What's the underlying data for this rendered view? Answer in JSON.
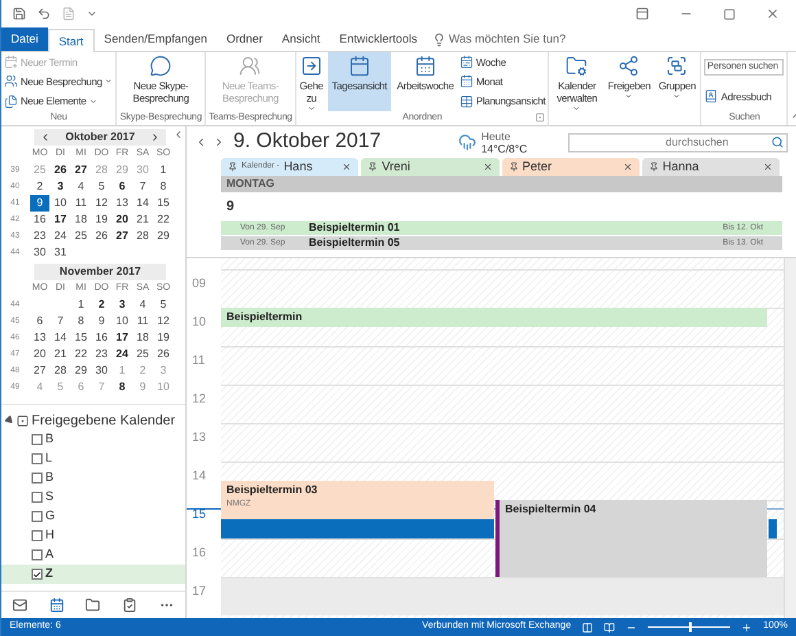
{
  "tabs": [
    {
      "label": "Datei",
      "kind": "file",
      "selected": false
    },
    {
      "label": "Start",
      "kind": "tab",
      "selected": true
    },
    {
      "label": "Senden/Empfangen",
      "kind": "tab",
      "selected": false
    },
    {
      "label": "Ordner",
      "kind": "tab",
      "selected": false
    },
    {
      "label": "Ansicht",
      "kind": "tab",
      "selected": false
    },
    {
      "label": "Entwicklertools",
      "kind": "tab",
      "selected": false
    }
  ],
  "tell_me": {
    "placeholder": "Was möchten Sie tun?"
  },
  "ribbon": {
    "groups": [
      {
        "label": "Neu",
        "items": [
          {
            "kind": "stack",
            "items": [
              {
                "kind": "small",
                "label": "Neuer Termin",
                "disabled": true,
                "dropdown": false,
                "selected": false
              },
              {
                "kind": "small",
                "label": "Neue Besprechung",
                "disabled": false,
                "dropdown": true,
                "selected": false
              },
              {
                "kind": "small",
                "label": "Neue Elemente",
                "disabled": false,
                "dropdown": true,
                "selected": false
              }
            ]
          }
        ]
      },
      {
        "label": "Skype-Besprechung",
        "items": [
          {
            "kind": "large",
            "label": "Neue Skype-Besprechung",
            "disabled": false,
            "dropdown": false,
            "selected": false
          }
        ]
      },
      {
        "label": "Teams-Besprechung",
        "items": [
          {
            "kind": "large",
            "label": "Neue Teams-Besprechung",
            "disabled": true,
            "dropdown": false,
            "selected": false
          }
        ]
      },
      {
        "label": "Anordnen",
        "launcher": true,
        "items": [
          {
            "kind": "large",
            "label": "Gehe zu",
            "disabled": false,
            "dropdown": true,
            "selected": false
          },
          {
            "kind": "large",
            "label": "Tagesansicht",
            "disabled": false,
            "dropdown": false,
            "selected": true
          },
          {
            "kind": "large",
            "label": "Arbeitswoche",
            "disabled": false,
            "dropdown": false,
            "selected": false
          },
          {
            "kind": "stack",
            "items": [
              {
                "kind": "small",
                "label": "Woche",
                "disabled": false,
                "dropdown": false,
                "selected": false
              },
              {
                "kind": "small",
                "label": "Monat",
                "disabled": false,
                "dropdown": false,
                "selected": false
              },
              {
                "kind": "small",
                "label": "Planungsansicht",
                "disabled": false,
                "dropdown": false,
                "selected": false
              }
            ]
          }
        ]
      },
      {
        "items": [
          {
            "kind": "large",
            "label": "Kalender verwalten",
            "disabled": false,
            "dropdown": true,
            "selected": false
          },
          {
            "kind": "large",
            "label": "Freigeben",
            "disabled": false,
            "dropdown": true,
            "selected": false
          },
          {
            "kind": "large",
            "label": "Gruppen",
            "disabled": false,
            "dropdown": true,
            "selected": false
          }
        ]
      },
      {
        "label": "Suchen",
        "items": [
          {
            "kind": "stack",
            "items": [
              {
                "kind": "search",
                "placeholder": "Personen suchen"
              },
              {
                "kind": "small",
                "label": "Adressbuch",
                "disabled": false,
                "dropdown": false,
                "selected": false
              }
            ]
          }
        ]
      }
    ]
  },
  "mini_calendar": {
    "months": [
      {
        "title": "Oktober 2017",
        "nav": true,
        "weekdays": [
          "MO",
          "DI",
          "MI",
          "DO",
          "FR",
          "SA",
          "SO"
        ],
        "weeks": [
          {
            "week": "39",
            "days": [
              {
                "day": "25",
                "kind": "other"
              },
              {
                "day": "26",
                "kind": "bold"
              },
              {
                "day": "27",
                "kind": "bold"
              },
              {
                "day": "28",
                "kind": "other"
              },
              {
                "day": "29",
                "kind": "other"
              },
              {
                "day": "30",
                "kind": "other"
              },
              {
                "day": "1",
                "kind": "normal"
              }
            ]
          },
          {
            "week": "40",
            "days": [
              {
                "day": "2",
                "kind": "normal"
              },
              {
                "day": "3",
                "kind": "bold"
              },
              {
                "day": "4",
                "kind": "normal"
              },
              {
                "day": "5",
                "kind": "normal"
              },
              {
                "day": "6",
                "kind": "bold"
              },
              {
                "day": "7",
                "kind": "normal"
              },
              {
                "day": "8",
                "kind": "normal"
              }
            ]
          },
          {
            "week": "41",
            "days": [
              {
                "day": "9",
                "kind": "selected"
              },
              {
                "day": "10",
                "kind": "normal"
              },
              {
                "day": "11",
                "kind": "normal"
              },
              {
                "day": "12",
                "kind": "normal"
              },
              {
                "day": "13",
                "kind": "normal"
              },
              {
                "day": "14",
                "kind": "normal"
              },
              {
                "day": "15",
                "kind": "normal"
              }
            ]
          },
          {
            "week": "42",
            "days": [
              {
                "day": "16",
                "kind": "normal"
              },
              {
                "day": "17",
                "kind": "bold"
              },
              {
                "day": "18",
                "kind": "normal"
              },
              {
                "day": "19",
                "kind": "normal"
              },
              {
                "day": "20",
                "kind": "bold"
              },
              {
                "day": "21",
                "kind": "normal"
              },
              {
                "day": "22",
                "kind": "normal"
              }
            ]
          },
          {
            "week": "43",
            "days": [
              {
                "day": "23",
                "kind": "normal"
              },
              {
                "day": "24",
                "kind": "normal"
              },
              {
                "day": "25",
                "kind": "normal"
              },
              {
                "day": "26",
                "kind": "normal"
              },
              {
                "day": "27",
                "kind": "bold"
              },
              {
                "day": "28",
                "kind": "normal"
              },
              {
                "day": "29",
                "kind": "normal"
              }
            ]
          },
          {
            "week": "44",
            "days": [
              {
                "day": "30",
                "kind": "normal"
              },
              {
                "day": "31",
                "kind": "normal"
              }
            ]
          }
        ]
      },
      {
        "title": "November 2017",
        "nav": false,
        "weekdays": [
          "MO",
          "DI",
          "MI",
          "DO",
          "FR",
          "SA",
          "SO"
        ],
        "weeks": [
          {
            "week": "44",
            "days": [
              {
                "kind": "blank"
              },
              {
                "kind": "blank"
              },
              {
                "day": "1",
                "kind": "normal"
              },
              {
                "day": "2",
                "kind": "bold"
              },
              {
                "day": "3",
                "kind": "bold"
              },
              {
                "day": "4",
                "kind": "normal"
              },
              {
                "day": "5",
                "kind": "normal"
              }
            ]
          },
          {
            "week": "45",
            "days": [
              {
                "day": "6",
                "kind": "normal"
              },
              {
                "day": "7",
                "kind": "normal"
              },
              {
                "day": "8",
                "kind": "normal"
              },
              {
                "day": "9",
                "kind": "normal"
              },
              {
                "day": "10",
                "kind": "normal"
              },
              {
                "day": "11",
                "kind": "normal"
              },
              {
                "day": "12",
                "kind": "normal"
              }
            ]
          },
          {
            "week": "46",
            "days": [
              {
                "day": "13",
                "kind": "normal"
              },
              {
                "day": "14",
                "kind": "normal"
              },
              {
                "day": "15",
                "kind": "normal"
              },
              {
                "day": "16",
                "kind": "normal"
              },
              {
                "day": "17",
                "kind": "bold"
              },
              {
                "day": "18",
                "kind": "normal"
              },
              {
                "day": "19",
                "kind": "normal"
              }
            ]
          },
          {
            "week": "47",
            "days": [
              {
                "day": "20",
                "kind": "normal"
              },
              {
                "day": "21",
                "kind": "normal"
              },
              {
                "day": "22",
                "kind": "normal"
              },
              {
                "day": "23",
                "kind": "normal"
              },
              {
                "day": "24",
                "kind": "bold"
              },
              {
                "day": "25",
                "kind": "normal"
              },
              {
                "day": "26",
                "kind": "normal"
              }
            ]
          },
          {
            "week": "48",
            "days": [
              {
                "day": "27",
                "kind": "normal"
              },
              {
                "day": "28",
                "kind": "normal"
              },
              {
                "day": "29",
                "kind": "normal"
              },
              {
                "day": "30",
                "kind": "normal"
              },
              {
                "day": "1",
                "kind": "other"
              },
              {
                "day": "2",
                "kind": "other"
              },
              {
                "day": "3",
                "kind": "other"
              }
            ]
          },
          {
            "week": "49",
            "days": [
              {
                "day": "4",
                "kind": "other"
              },
              {
                "day": "5",
                "kind": "other"
              },
              {
                "day": "6",
                "kind": "other"
              },
              {
                "day": "7",
                "kind": "other"
              },
              {
                "day": "8",
                "kind": "bold"
              },
              {
                "day": "9",
                "kind": "other"
              },
              {
                "day": "10",
                "kind": "other"
              }
            ]
          }
        ]
      }
    ]
  },
  "shared_calendars": {
    "title": "Freigegebene Kalender",
    "expanded": true,
    "items": [
      {
        "label": "B",
        "checked": false,
        "selected": false
      },
      {
        "label": "L",
        "checked": false,
        "selected": false
      },
      {
        "label": "B",
        "checked": false,
        "selected": false
      },
      {
        "label": "S",
        "checked": false,
        "selected": false
      },
      {
        "label": "G",
        "checked": false,
        "selected": false
      },
      {
        "label": "H",
        "checked": false,
        "selected": false
      },
      {
        "label": "A",
        "checked": false,
        "selected": false
      },
      {
        "label": "Z",
        "checked": true,
        "selected": true
      }
    ]
  },
  "nav_bar": [
    {
      "kind": "mail",
      "selected": false
    },
    {
      "kind": "calendar",
      "selected": true
    },
    {
      "kind": "people",
      "selected": false
    },
    {
      "kind": "tasks",
      "selected": false
    },
    {
      "kind": "more",
      "selected": false
    }
  ],
  "header": {
    "date": "9. Oktober 2017",
    "weather": {
      "label": "Heute",
      "temperature": "14°C/8°C"
    },
    "search": {
      "placeholder": "durchsuchen"
    }
  },
  "calendars": [
    {
      "prefix": "Kalender -",
      "name": "Hans",
      "color": "#d6ebfa"
    },
    {
      "name": "Vreni",
      "color": "#d2ead2"
    },
    {
      "name": "Peter",
      "color": "#fbdcc6"
    },
    {
      "name": "Hanna",
      "color": "#e0e0e0"
    }
  ],
  "day": {
    "weekday": "MONTAG",
    "number": "9"
  },
  "all_day": [
    {
      "from": "Von 29. Sep",
      "title": "Beispieltermin 01",
      "to": "Bis 12. Okt",
      "color": "#cdebcd"
    },
    {
      "from": "Von 29. Sep",
      "title": "Beispieltermin 05",
      "to": "Bis 13. Okt",
      "color": "#d6d6d6"
    }
  ],
  "hours": [
    {
      "label": "09",
      "shaded": false,
      "current": false
    },
    {
      "label": "10",
      "shaded": false,
      "current": false,
      "events": [
        {
          "kind": "full",
          "title": "Beispieltermin",
          "color": "#cdebcd",
          "half_past": false,
          "one_hour": false,
          "two_hours": false
        }
      ]
    },
    {
      "label": "11",
      "shaded": false,
      "current": false
    },
    {
      "label": "12",
      "shaded": false,
      "current": false
    },
    {
      "label": "13",
      "shaded": false,
      "current": false
    },
    {
      "label": "14",
      "shaded": false,
      "current": false,
      "events": [
        {
          "kind": "left",
          "title": "Beispieltermin 03",
          "location": "NMGZ",
          "color": "#fbdcc6",
          "half_past": true,
          "one_hour": true,
          "two_hours": false
        }
      ]
    },
    {
      "label": "15",
      "shaded": false,
      "current": true,
      "events": [
        {
          "kind": "left",
          "color": "#0a6ebd",
          "half_past": true,
          "one_hour": false,
          "two_hours": false
        },
        {
          "kind": "right",
          "title": "Beispieltermin 04",
          "color": "#d6d6d6",
          "border": {
            "color": "#7a1a7a"
          },
          "half_past": false,
          "one_hour": false,
          "two_hours": true
        },
        {
          "kind": "edge",
          "color": "#0a6ebd",
          "half_past": true,
          "one_hour": false,
          "two_hours": false
        }
      ]
    },
    {
      "label": "16",
      "shaded": false,
      "current": false
    },
    {
      "label": "17",
      "shaded": true,
      "current": false
    }
  ],
  "status_bar": {
    "items": "Elemente: 6",
    "connection": "Verbunden mit Microsoft Exchange",
    "zoom": {
      "level": 0.5,
      "reading": "100%"
    }
  }
}
